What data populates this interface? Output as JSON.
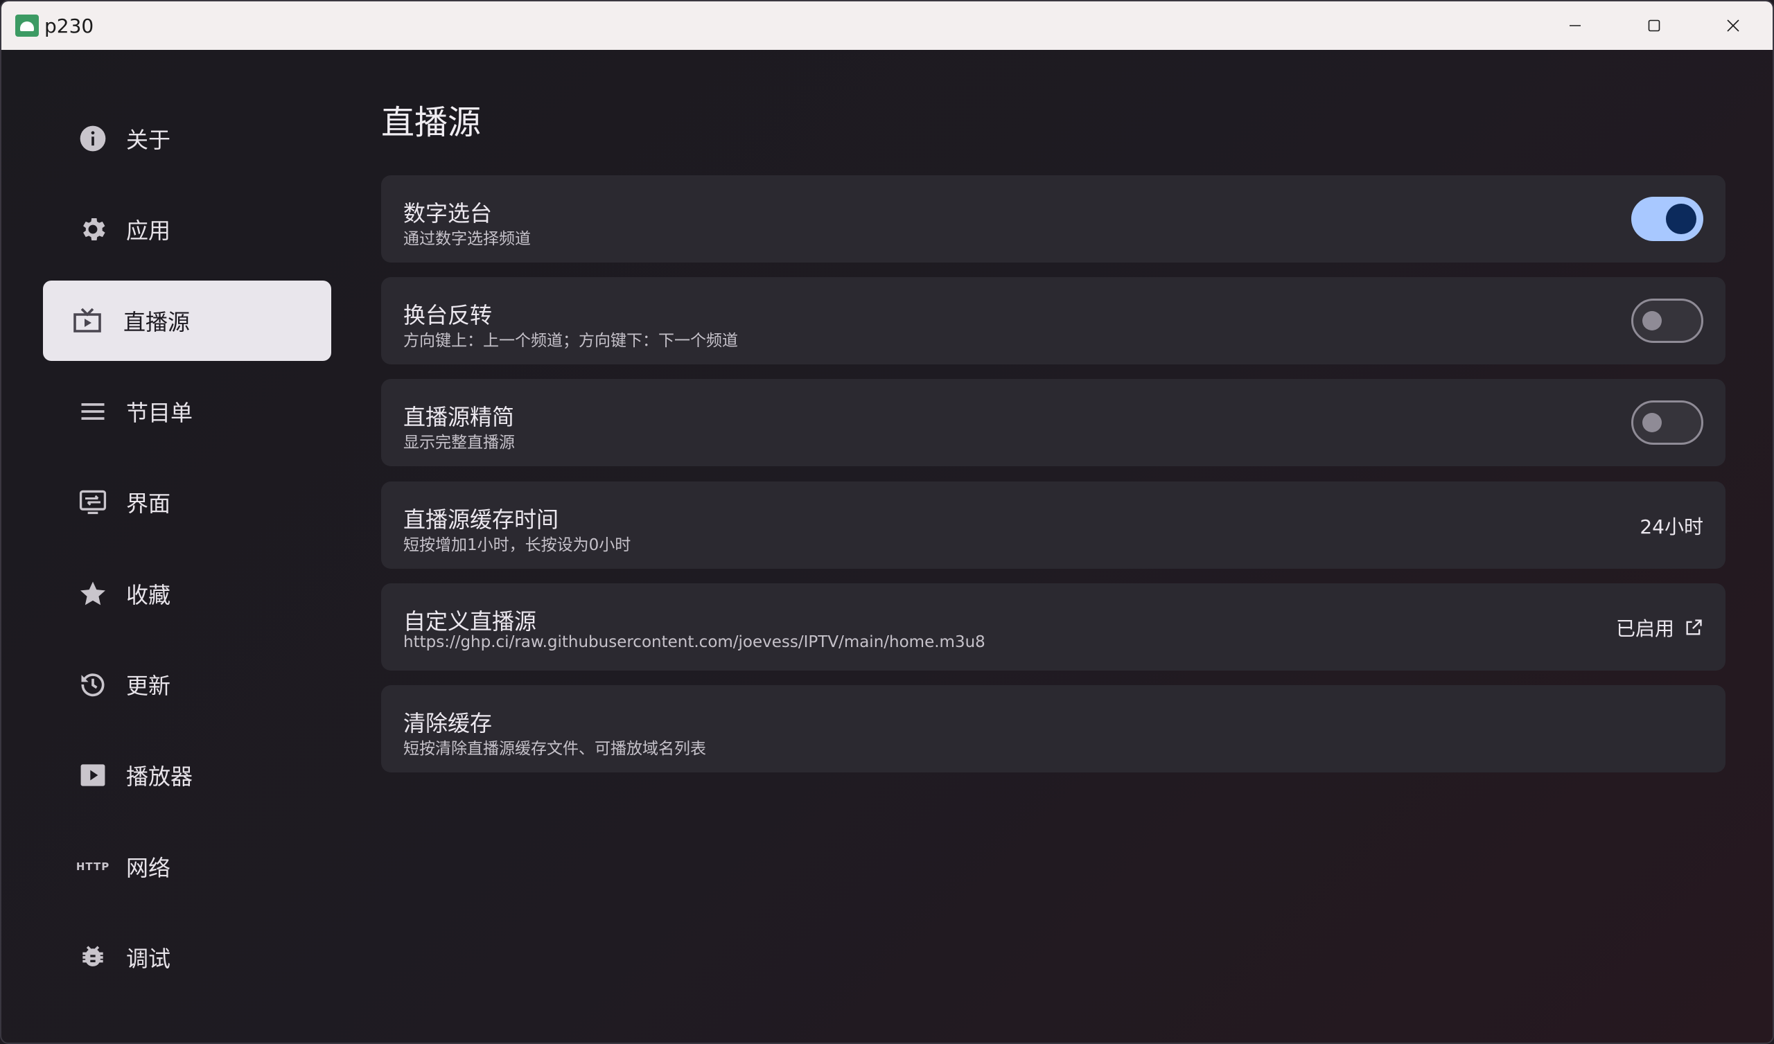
{
  "window": {
    "title": "p230",
    "icon": "android-icon"
  },
  "sidebar": {
    "items": [
      {
        "label": "关于",
        "icon": "info-icon"
      },
      {
        "label": "应用",
        "icon": "gear-icon"
      },
      {
        "label": "直播源",
        "icon": "live-tv-icon",
        "active": true
      },
      {
        "label": "节目单",
        "icon": "menu-list-icon"
      },
      {
        "label": "界面",
        "icon": "subtitles-icon"
      },
      {
        "label": "收藏",
        "icon": "star-icon"
      },
      {
        "label": "更新",
        "icon": "history-update-icon"
      },
      {
        "label": "播放器",
        "icon": "play-box-icon"
      },
      {
        "label": "网络",
        "icon": "http-icon",
        "icon_text": "HTTP"
      },
      {
        "label": "调试",
        "icon": "bug-icon"
      }
    ]
  },
  "main": {
    "title": "直播源",
    "settings": [
      {
        "title": "数字选台",
        "subtitle": "通过数字选择频道",
        "type": "toggle",
        "on": true
      },
      {
        "title": "换台反转",
        "subtitle": "方向键上：上一个频道；方向键下：下一个频道",
        "type": "toggle",
        "on": false
      },
      {
        "title": "直播源精简",
        "subtitle": "显示完整直播源",
        "type": "toggle",
        "on": false
      },
      {
        "title": "直播源缓存时间",
        "subtitle": "短按增加1小时，长按设为0小时",
        "type": "value",
        "value": "24小时"
      },
      {
        "title": "自定义直播源",
        "subtitle": "https://ghp.ci/raw.githubusercontent.com/joevess/IPTV/main/home.m3u8",
        "type": "link",
        "value": "已启用",
        "icon": "open-external-icon"
      },
      {
        "title": "清除缓存",
        "subtitle": "短按清除直播源缓存文件、可播放域名列表",
        "type": "action"
      }
    ]
  },
  "colors": {
    "toggle_on_track": "#a8c8ff",
    "toggle_on_knob": "#0c2a5c",
    "card_bg": "#2b2930",
    "active_nav_bg": "#e9e6ec"
  }
}
